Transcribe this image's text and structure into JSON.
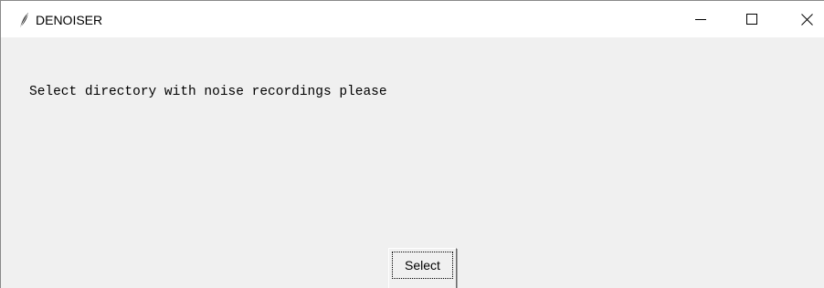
{
  "window": {
    "title": "DENOISER",
    "app_icon": "feather-icon",
    "controls": {
      "minimize_icon": "minimize-icon",
      "maximize_icon": "maximize-icon",
      "close_icon": "close-icon"
    }
  },
  "main": {
    "prompt_text": "Select directory with noise recordings please",
    "select_button_label": "Select"
  },
  "colors": {
    "titlebar_bg": "#ffffff",
    "client_bg": "#f0f0f0",
    "text": "#000000"
  }
}
